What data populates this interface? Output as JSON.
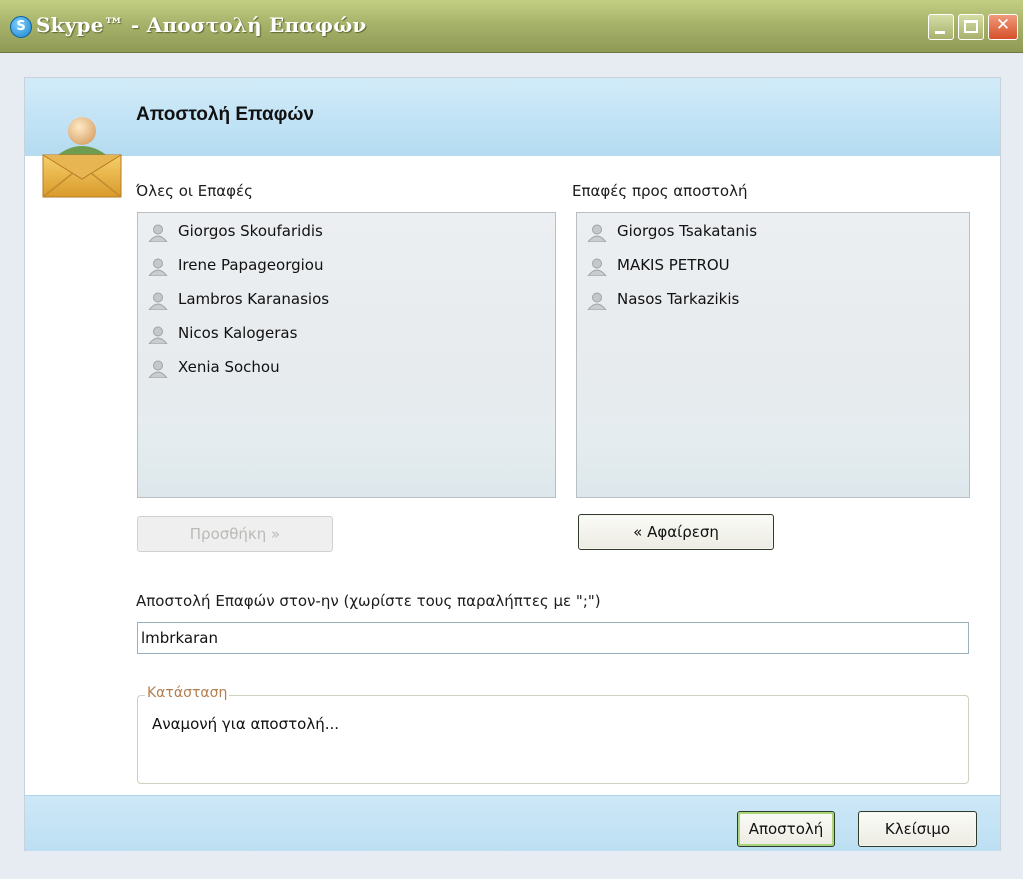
{
  "window": {
    "title": "Skype™ - Αποστολή Επαφών",
    "app_icon_glyph": "S"
  },
  "dialog": {
    "title": "Αποστολή Επαφών"
  },
  "all_contacts": {
    "label": "Όλες οι Επαφές",
    "items": [
      {
        "name": "Giorgos Skoufaridis"
      },
      {
        "name": "Irene Papageorgiou"
      },
      {
        "name": "Lambros Karanasios"
      },
      {
        "name": "Nicos Kalogeras"
      },
      {
        "name": "Xenia Sochou"
      }
    ]
  },
  "send_contacts": {
    "label": "Επαφές προς αποστολή",
    "items": [
      {
        "name": "Giorgos Tsakatanis"
      },
      {
        "name": "MAKIS PETROU"
      },
      {
        "name": "Nasos Tarkazikis"
      }
    ]
  },
  "buttons": {
    "add": "Προσθήκη »",
    "remove": "« Αφαίρεση",
    "send": "Αποστολή",
    "close": "Κλείσιμο"
  },
  "recipients": {
    "label": "Αποστολή Επαφών στον-ην (χωρίστε τους παραλήπτες με \";\")",
    "value": "lmbrkaran"
  },
  "status": {
    "legend": "Κατάσταση",
    "text": "Αναμονή για αποστολή..."
  },
  "colors": {
    "titlebar": "#a7b36a",
    "header_band": "#c0e2f5",
    "list_bg": "#e7ebee",
    "close_button": "#d4502a"
  },
  "icons": {
    "contact": "contact-offline-icon",
    "header": "send-contacts-envelope-icon"
  }
}
